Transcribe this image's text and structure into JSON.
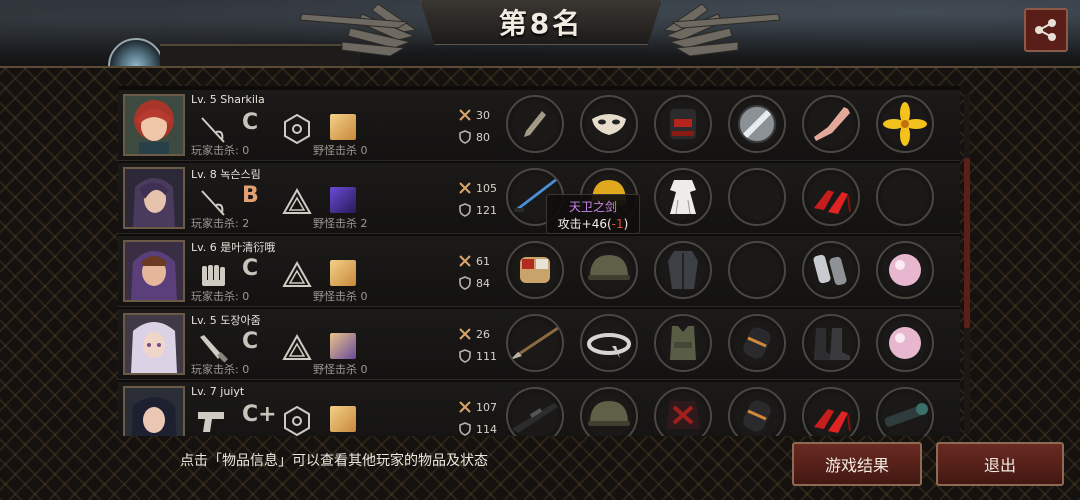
{
  "header": {
    "rank_title": "第8名"
  },
  "share_button": {
    "icon": "share-icon"
  },
  "colors": {
    "accent_red": "#5a1e18",
    "panel_bg": "#0d0c0b",
    "tooltip_name": "#c886e8",
    "negative": "#e04a3a"
  },
  "players": [
    {
      "level_name": "Lv. 5  Sharkila",
      "weapon_icon": "rapier-icon",
      "grade": "C",
      "route_icon": "hexagon-route-icon",
      "skill_icon": "skill-icon",
      "player_kills": "玩家击杀: 0",
      "monster_kills": "野怪击杀 0",
      "attack": "30",
      "defense": "80",
      "items": [
        "dagger-item",
        "mask-item",
        "backpack-armor-item",
        "disc-item",
        "leg-item",
        "lily-item"
      ]
    },
    {
      "level_name": "Lv. 8  녹슨스림",
      "weapon_icon": "rapier-icon",
      "grade": "B",
      "route_icon": "triangle-route-icon",
      "skill_icon": "skill-icon",
      "player_kills": "玩家击杀: 2",
      "monster_kills": "野怪击杀 2",
      "attack": "105",
      "defense": "121",
      "items": [
        "blue-sword-item",
        "gold-helmet-item",
        "white-dress-item",
        "empty-slot",
        "red-heels-item",
        "empty-slot"
      ]
    },
    {
      "level_name": "Lv. 6  是叶清衍哦",
      "weapon_icon": "fist-icon",
      "grade": "C",
      "route_icon": "triangle-route-icon",
      "skill_icon": "skill-icon",
      "player_kills": "玩家击杀: 0",
      "monster_kills": "野怪击杀 0",
      "attack": "61",
      "defense": "84",
      "items": [
        "gauntlet-item",
        "army-helmet-item",
        "dark-coat-item",
        "empty-slot",
        "bracer-item",
        "pearl-item"
      ]
    },
    {
      "level_name": "Lv. 5  도장아줌",
      "weapon_icon": "knife-icon",
      "grade": "C",
      "route_icon": "triangle-route-icon",
      "skill_icon": "skill-icon",
      "player_kills": "玩家击杀: 0",
      "monster_kills": "野怪击杀 0",
      "attack": "26",
      "defense": "111",
      "items": [
        "spear-item",
        "circlet-item",
        "vest-item",
        "armguard-item",
        "boots-item",
        "pearl-item"
      ]
    },
    {
      "level_name": "Lv. 7  juiyt",
      "weapon_icon": "pistol-icon",
      "grade": "C+",
      "route_icon": "hexagon-route-icon",
      "skill_icon": "skill-icon",
      "player_kills": "",
      "monster_kills": "",
      "attack": "107",
      "defense": "114",
      "items": [
        "rifle-item",
        "army-helmet-item",
        "red-armor-item",
        "armguard-item",
        "red-heels-item",
        "scope-item"
      ]
    }
  ],
  "tooltip": {
    "item_name": "天卫之剑",
    "stat_prefix": "攻击+46(",
    "stat_negative": "-1",
    "stat_suffix": ")"
  },
  "footer": {
    "hint": "点击「物品信息」可以查看其他玩家的物品及状态",
    "result_button": "游戏结果",
    "exit_button": "退出"
  }
}
